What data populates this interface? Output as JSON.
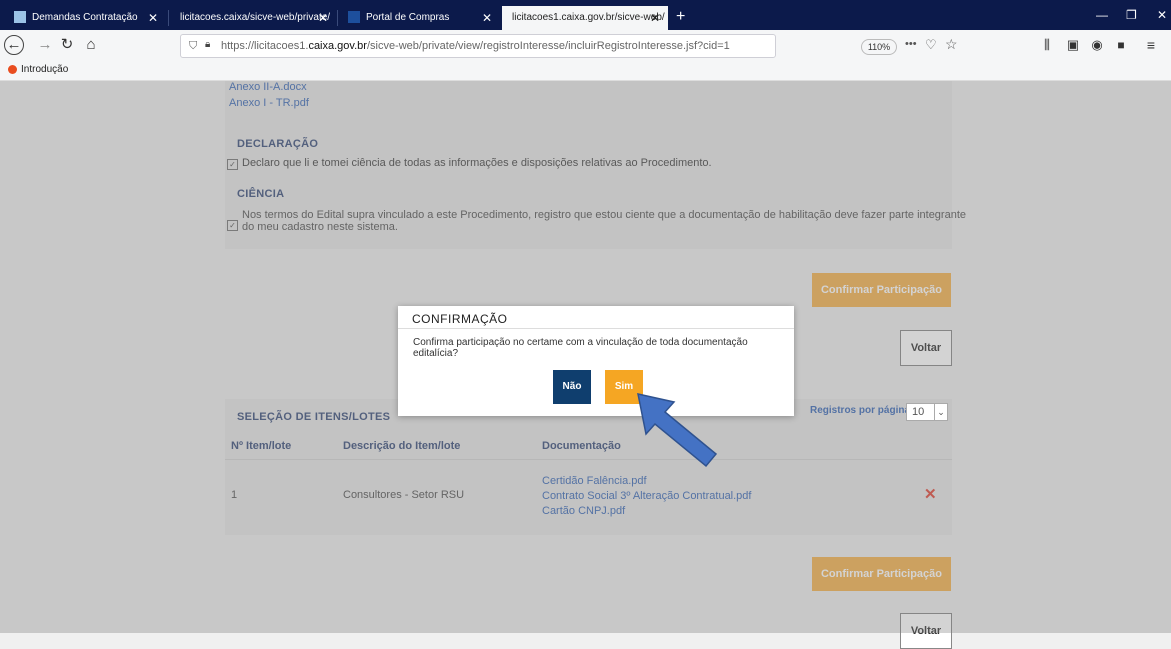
{
  "browser": {
    "tabs": [
      {
        "label": "Demandas Contratação"
      },
      {
        "label": "licitacoes.caixa/sicve-web/private/"
      },
      {
        "label": "Portal de Compras"
      },
      {
        "label": "licitacoes1.caixa.gov.br/sicve-web/"
      }
    ],
    "url_prefix": "https://licitacoes1.",
    "url_domain": "caixa.gov.br",
    "url_rest": "/sicve-web/private/view/registroInteresse/incluirRegistroInteresse.jsf?cid=1",
    "zoom": "110%",
    "bookmark": "Introdução"
  },
  "attachments": [
    "Anexo II-A.docx",
    "Anexo I - TR.pdf"
  ],
  "declaracao": {
    "title": "DECLARAÇÃO",
    "text": "Declaro que li e tomei ciência de todas as informações e disposições relativas ao Procedimento."
  },
  "ciencia": {
    "title": "CIÊNCIA",
    "line1": "Nos termos do Edital supra vinculado a este Procedimento, registro que estou ciente que a documentação de habilitação deve fazer parte integrante",
    "line2": "do meu cadastro neste sistema."
  },
  "buttons": {
    "confirm": "Confirmar Participação",
    "back": "Voltar"
  },
  "selecao": {
    "title": "SELEÇÃO DE ITENS/LOTES",
    "per_page_label": "Registros por página",
    "per_page_value": "10",
    "headers": [
      "Nº Item/lote",
      "Descrição do Item/lote",
      "Documentação"
    ],
    "row": {
      "num": "1",
      "desc": "Consultores - Setor RSU",
      "docs": [
        "Certidão Falência.pdf",
        "Contrato Social 3º Alteração Contratual.pdf",
        "Cartão CNPJ.pdf"
      ]
    }
  },
  "dialog": {
    "title": "CONFIRMAÇÃO",
    "message": "Confirma participação no certame com a vinculação de toda documentação editalícia?",
    "no": "Não",
    "yes": "Sim"
  },
  "colors": {
    "accent_orange": "#f5a623",
    "navy": "#0f3e6e",
    "arrow": "#4472c4"
  }
}
